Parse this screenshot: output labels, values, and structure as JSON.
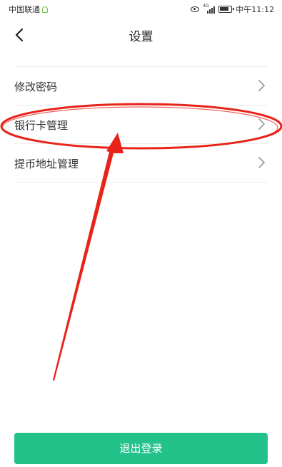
{
  "status_bar": {
    "carrier": "中国联通",
    "time": "中午11:12",
    "network_label": "4G"
  },
  "header": {
    "title": "设置"
  },
  "menu": {
    "items": [
      {
        "label": "修改密码"
      },
      {
        "label": "银行卡管理"
      },
      {
        "label": "提币地址管理"
      }
    ]
  },
  "footer": {
    "logout_label": "退出登录"
  },
  "colors": {
    "accent": "#24c28b",
    "annotation": "#e8231a"
  }
}
